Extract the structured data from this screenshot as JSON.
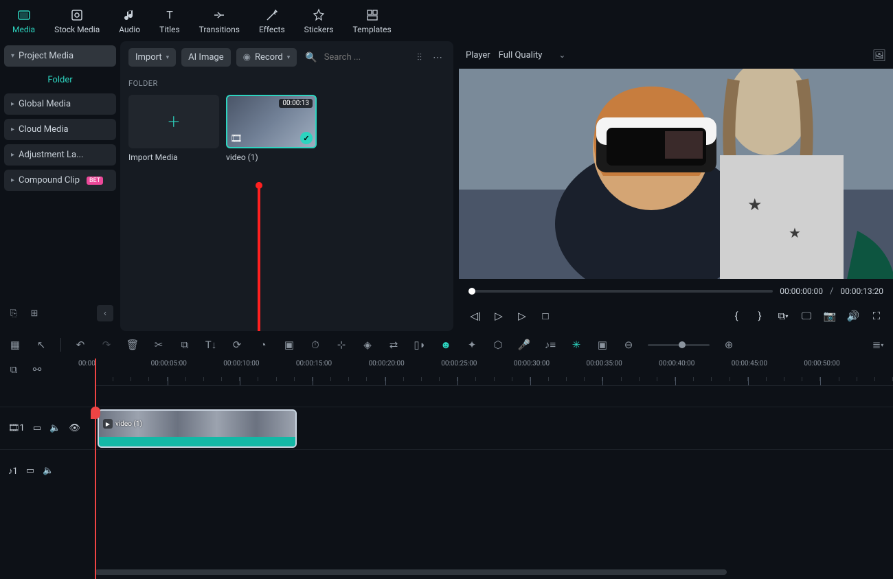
{
  "top_tabs": {
    "media": "Media",
    "stock": "Stock Media",
    "audio": "Audio",
    "titles": "Titles",
    "transitions": "Transitions",
    "effects": "Effects",
    "stickers": "Stickers",
    "templates": "Templates"
  },
  "sidebar": {
    "project_media": "Project Media",
    "folder_label": "Folder",
    "global_media": "Global Media",
    "cloud_media": "Cloud Media",
    "adjustment": "Adjustment La...",
    "compound": "Compound Clip",
    "beta_badge": "BET"
  },
  "center": {
    "import_btn": "Import",
    "ai_image_btn": "AI Image",
    "record_btn": "Record",
    "search_placeholder": "Search ...",
    "folder_header": "FOLDER",
    "import_media_label": "Import Media",
    "video_duration": "00:00:13",
    "video_name": "video (1)"
  },
  "player": {
    "title": "Player",
    "quality": "Full Quality",
    "current_time": "00:00:00:00",
    "separator": "/",
    "total_time": "00:00:13:20"
  },
  "timeline": {
    "ruler_labels": [
      "00:00",
      "00:00:05:00",
      "00:00:10:00",
      "00:00:15:00",
      "00:00:20:00",
      "00:00:25:00",
      "00:00:30:00",
      "00:00:35:00",
      "00:00:40:00",
      "00:00:45:00",
      "00:00:50:00"
    ],
    "video_track_num": "1",
    "audio_track_num": "1",
    "clip_name": "video (1)"
  }
}
